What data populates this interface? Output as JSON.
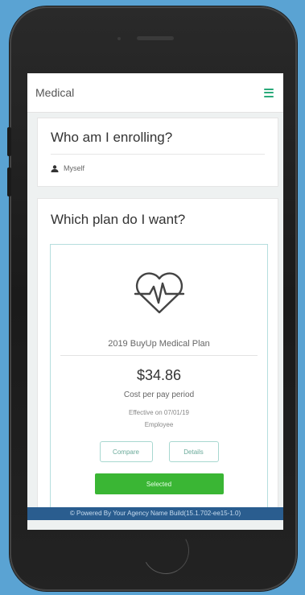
{
  "header": {
    "title": "Medical",
    "menu_icon": "hamburger-menu-icon"
  },
  "enrollment": {
    "heading": "Who am I enrolling?",
    "person_icon": "person-icon",
    "person_label": "Myself"
  },
  "plan_section": {
    "heading": "Which plan do I want?",
    "plan": {
      "icon": "heart-pulse-icon",
      "name": "2019 BuyUp Medical Plan",
      "price": "$34.86",
      "price_label": "Cost per pay period",
      "effective": "Effective on 07/01/19",
      "tier": "Employee",
      "compare_label": "Compare",
      "details_label": "Details",
      "selected_label": "Selected"
    }
  },
  "footer": {
    "text": "© Powered By Your Agency Name Build(15.1.702-ee15-1.0)"
  },
  "colors": {
    "background": "#5aa3d3",
    "accent_green": "#2aaa7a",
    "selected_green": "#3ab634",
    "footer_blue": "#2a5d8f",
    "plan_border": "#b5dede"
  }
}
